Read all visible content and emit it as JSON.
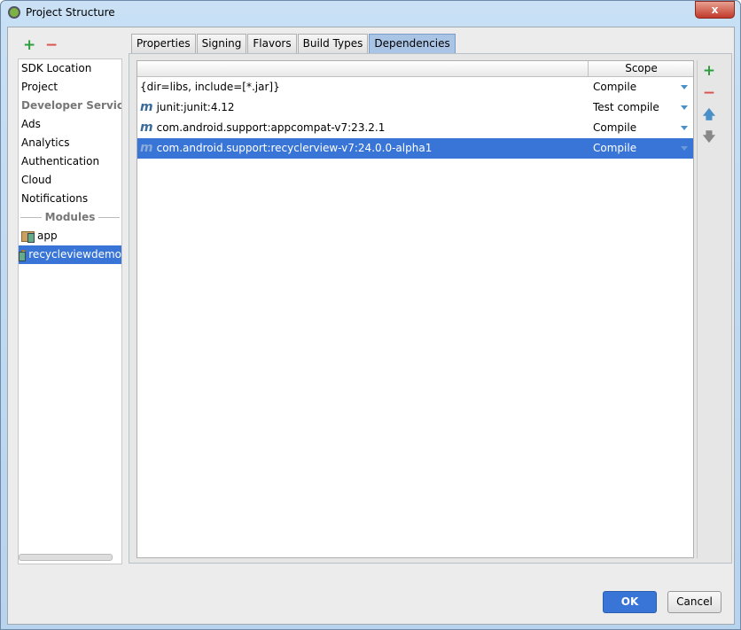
{
  "window": {
    "title": "Project Structure",
    "close": "x"
  },
  "toolbar": {
    "add": "+",
    "remove": "−"
  },
  "sidebar": {
    "items": [
      "SDK Location",
      "Project"
    ],
    "group": "Developer Services",
    "services": [
      "Ads",
      "Analytics",
      "Authentication",
      "Cloud",
      "Notifications"
    ],
    "modules_label": "Modules",
    "modules": [
      "app",
      "recycleviewdemo"
    ],
    "selected_module": "recycleviewdemo"
  },
  "tabs": [
    "Properties",
    "Signing",
    "Flavors",
    "Build Types",
    "Dependencies"
  ],
  "active_tab": "Dependencies",
  "table": {
    "header": {
      "scope": "Scope"
    },
    "rows": [
      {
        "name": "{dir=libs, include=[*.jar]}",
        "scope": "Compile",
        "icon": "none"
      },
      {
        "name": "junit:junit:4.12",
        "scope": "Test compile",
        "icon": "maven-icon"
      },
      {
        "name": "com.android.support:appcompat-v7:23.2.1",
        "scope": "Compile",
        "icon": "maven-icon"
      },
      {
        "name": "com.android.support:recyclerview-v7:24.0.0-alpha1",
        "scope": "Compile",
        "icon": "maven-icon",
        "selected": true
      }
    ]
  },
  "side_tools": {
    "add": "+",
    "remove": "−",
    "up": "🡅",
    "down": "🡇"
  },
  "buttons": {
    "ok": "OK",
    "cancel": "Cancel"
  },
  "colors": {
    "selection": "#3875d7",
    "add": "#2e9e3e",
    "remove": "#d9534f"
  }
}
